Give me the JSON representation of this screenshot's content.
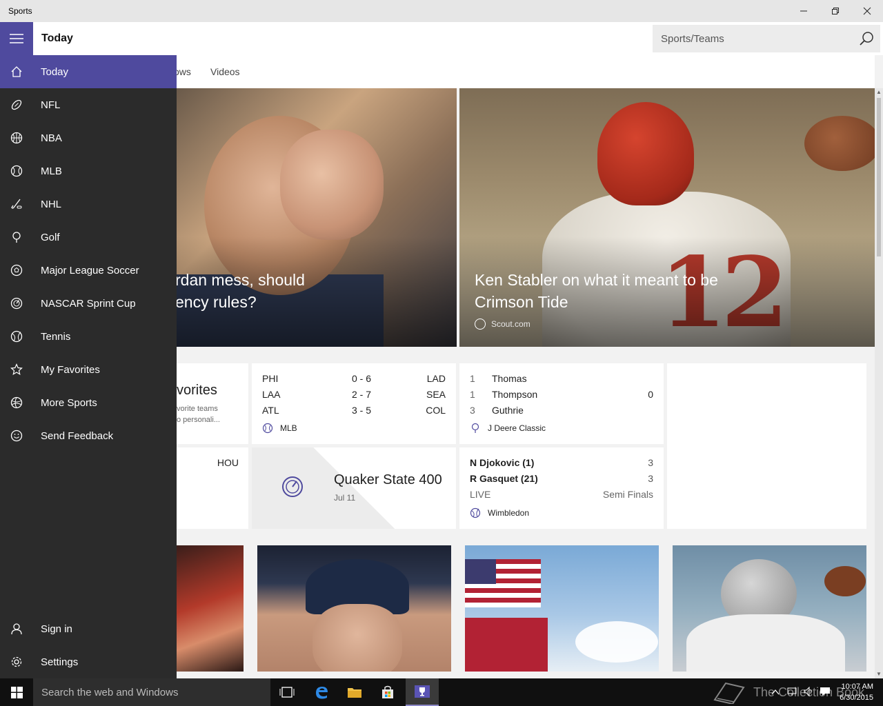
{
  "window": {
    "title": "Sports"
  },
  "header": {
    "page_title": "Today",
    "search_placeholder": "Sports/Teams"
  },
  "subtabs": [
    "ows",
    "Videos"
  ],
  "hero": [
    {
      "headline_line1": "rdan mess, should",
      "headline_line2": "ency rules?"
    },
    {
      "headline_line1": "Ken Stabler on what it meant to be",
      "headline_line2": "Crimson Tide",
      "source": "Scout.com",
      "jersey_number": "12"
    }
  ],
  "favorites_card": {
    "title": "vorites",
    "line1": "vorite teams",
    "line2": "o personali..."
  },
  "mlb_card": {
    "rows": [
      {
        "team1": "PHI",
        "score": "0  -  6",
        "team2": "LAD"
      },
      {
        "team1": "LAA",
        "score": "2  -  7",
        "team2": "SEA"
      },
      {
        "team1": "ATL",
        "score": "3  -  5",
        "team2": "COL"
      }
    ],
    "league": "MLB"
  },
  "golf_card": {
    "rows": [
      {
        "pos": "1",
        "name": "Thomas",
        "value": ""
      },
      {
        "pos": "1",
        "name": "Thompson",
        "value": "0"
      },
      {
        "pos": "3",
        "name": "Guthrie",
        "value": ""
      }
    ],
    "league": "J Deere Classic"
  },
  "partial_card": {
    "team": "HOU"
  },
  "nascar_card": {
    "title": "Quaker State 400",
    "date": "Jul 11"
  },
  "tennis_card": {
    "rows": [
      {
        "name": "N Djokovic (1)",
        "value": "3"
      },
      {
        "name": "R Gasquet (21)",
        "value": "3"
      }
    ],
    "status": "LIVE",
    "round": "Semi Finals",
    "league": "Wimbledon"
  },
  "sidebar": {
    "items": [
      {
        "label": "Today",
        "icon": "home-icon"
      },
      {
        "label": "NFL",
        "icon": "football-icon"
      },
      {
        "label": "NBA",
        "icon": "basketball-icon"
      },
      {
        "label": "MLB",
        "icon": "baseball-icon"
      },
      {
        "label": "NHL",
        "icon": "hockey-icon"
      },
      {
        "label": "Golf",
        "icon": "golf-icon"
      },
      {
        "label": "Major League Soccer",
        "icon": "soccer-icon"
      },
      {
        "label": "NASCAR Sprint Cup",
        "icon": "nascar-icon"
      },
      {
        "label": "Tennis",
        "icon": "tennis-icon"
      },
      {
        "label": "My Favorites",
        "icon": "star-icon"
      },
      {
        "label": "More Sports",
        "icon": "more-sports-icon"
      },
      {
        "label": "Send Feedback",
        "icon": "smiley-icon"
      }
    ],
    "bottom": [
      {
        "label": "Sign in",
        "icon": "person-icon"
      },
      {
        "label": "Settings",
        "icon": "gear-icon"
      }
    ]
  },
  "taskbar": {
    "search_placeholder": "Search the web and Windows",
    "time": "10:07 AM",
    "date": "6/30/2015",
    "watermark": "The Collection Book"
  },
  "colors": {
    "accent": "#4f4a9e",
    "sidebar": "#2b2b2b",
    "taskbar": "#101010"
  }
}
